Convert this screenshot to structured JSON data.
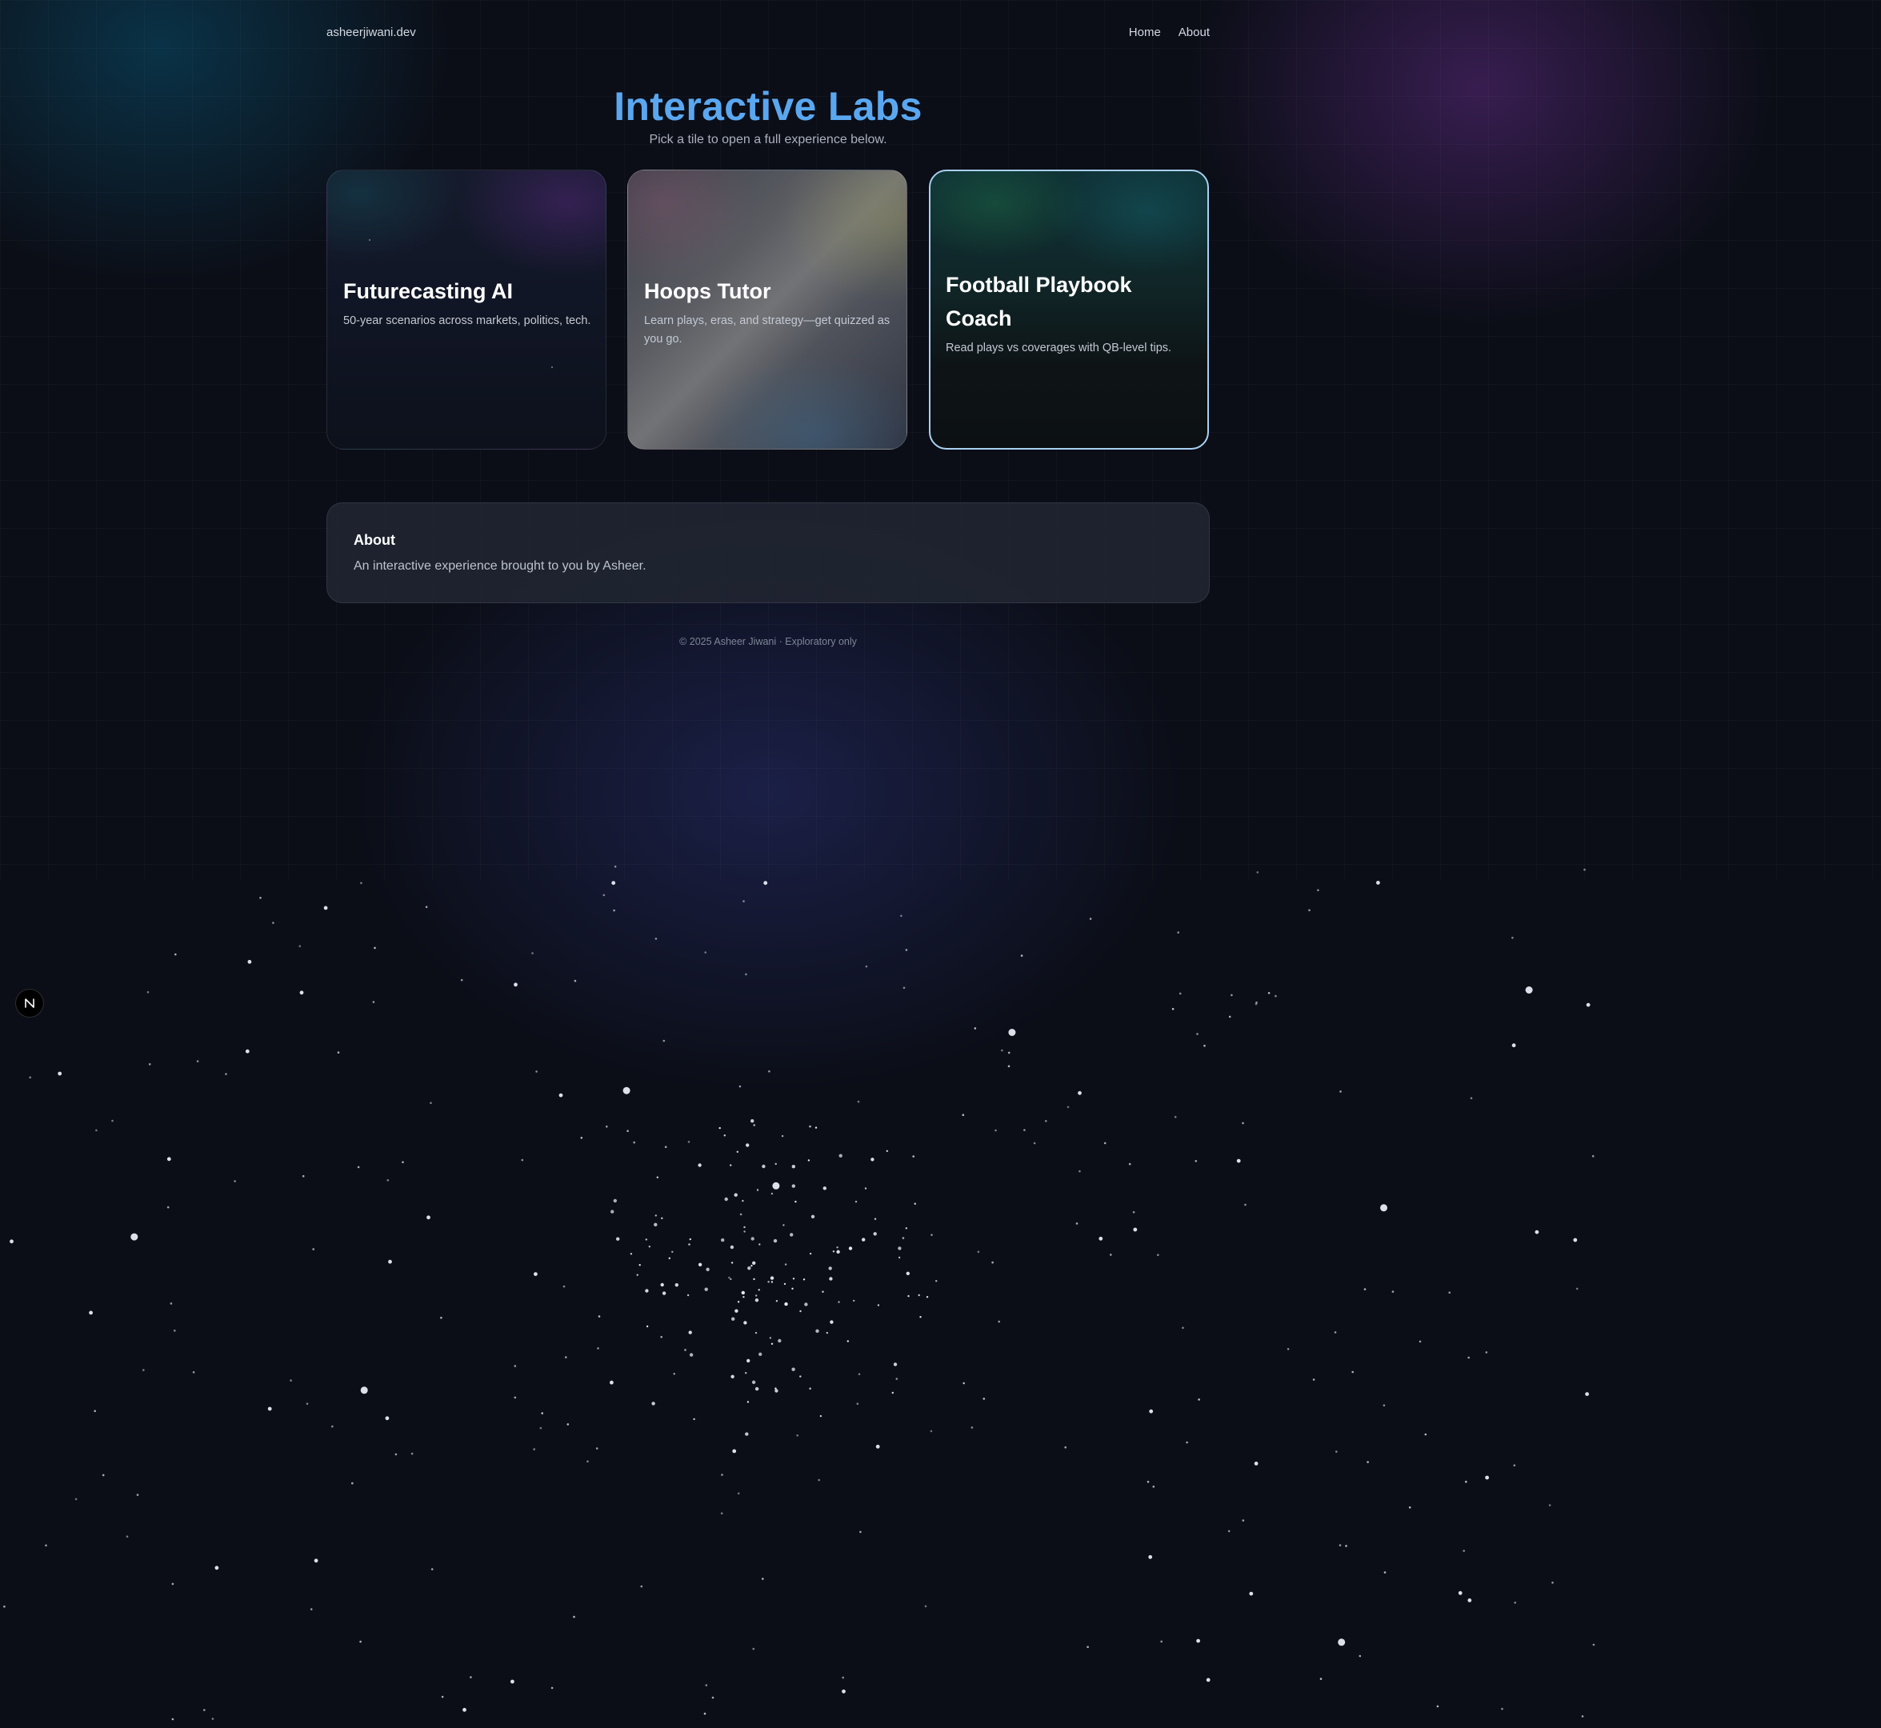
{
  "nav": {
    "brand": "asheerjiwani.dev",
    "links": [
      "Home",
      "About"
    ]
  },
  "hero": {
    "title": "Interactive Labs",
    "subtitle": "Pick a tile to open a full experience below."
  },
  "tiles": [
    {
      "title": "Futurecasting AI",
      "description": "50-year scenarios across markets, politics, tech."
    },
    {
      "title": "Hoops Tutor",
      "description": "Learn plays, eras, and strategy—get quizzed as you go."
    },
    {
      "title": "Football Playbook Coach",
      "description": "Read plays vs coverages with QB-level tips.",
      "selected": true
    }
  ],
  "about": {
    "title": "About",
    "text": "An interactive experience brought to you by Asheer."
  },
  "footer": {
    "text": "© 2025 Asheer Jiwani · Exploratory only"
  },
  "colors": {
    "background": "#0b0e17",
    "title_accent": "#5aa7f0",
    "selected_border": "#a9d0f2"
  },
  "icons": {
    "dev_badge": "next-logo-icon"
  }
}
